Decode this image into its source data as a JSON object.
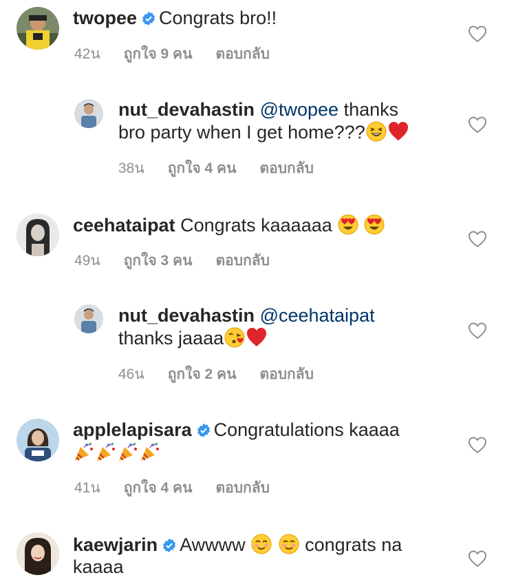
{
  "comments": [
    {
      "username": "twopee",
      "verified": true,
      "text": "Congrats bro!!",
      "time": "42น",
      "likes": "ถูกใจ 9 คน",
      "reply": "ตอบกลับ"
    },
    {
      "username": "nut_devahastin",
      "mention": "@twopee",
      "text_line1": "thanks",
      "text_line2": "bro party when I get home???",
      "emojis": [
        "grinning-squinting-face",
        "red-heart"
      ],
      "time": "38น",
      "likes": "ถูกใจ 4 คน",
      "reply": "ตอบกลับ"
    },
    {
      "username": "ceehataipat",
      "text": "Congrats kaaaaaa",
      "emojis": [
        "heart-eyes-face",
        "heart-eyes-face"
      ],
      "time": "49น",
      "likes": "ถูกใจ 3 คน",
      "reply": "ตอบกลับ"
    },
    {
      "username": "nut_devahastin",
      "mention": "@ceehataipat",
      "text_line2": "thanks jaaaa",
      "emojis": [
        "face-blowing-kiss",
        "red-heart"
      ],
      "time": "46น",
      "likes": "ถูกใจ 2 คน",
      "reply": "ตอบกลับ"
    },
    {
      "username": "applelapisara",
      "verified": true,
      "text": "Congratulations kaaaa",
      "emojis": [
        "party-popper",
        "party-popper",
        "party-popper",
        "party-popper"
      ],
      "time": "41น",
      "likes": "ถูกใจ 4 คน",
      "reply": "ตอบกลับ"
    },
    {
      "username": "kaewjarin",
      "verified": true,
      "text": "Awwww",
      "emojis": [
        "smiling-face",
        "smiling-face"
      ],
      "text_after": "congrats na",
      "text_line2": "kaaaa"
    }
  ]
}
